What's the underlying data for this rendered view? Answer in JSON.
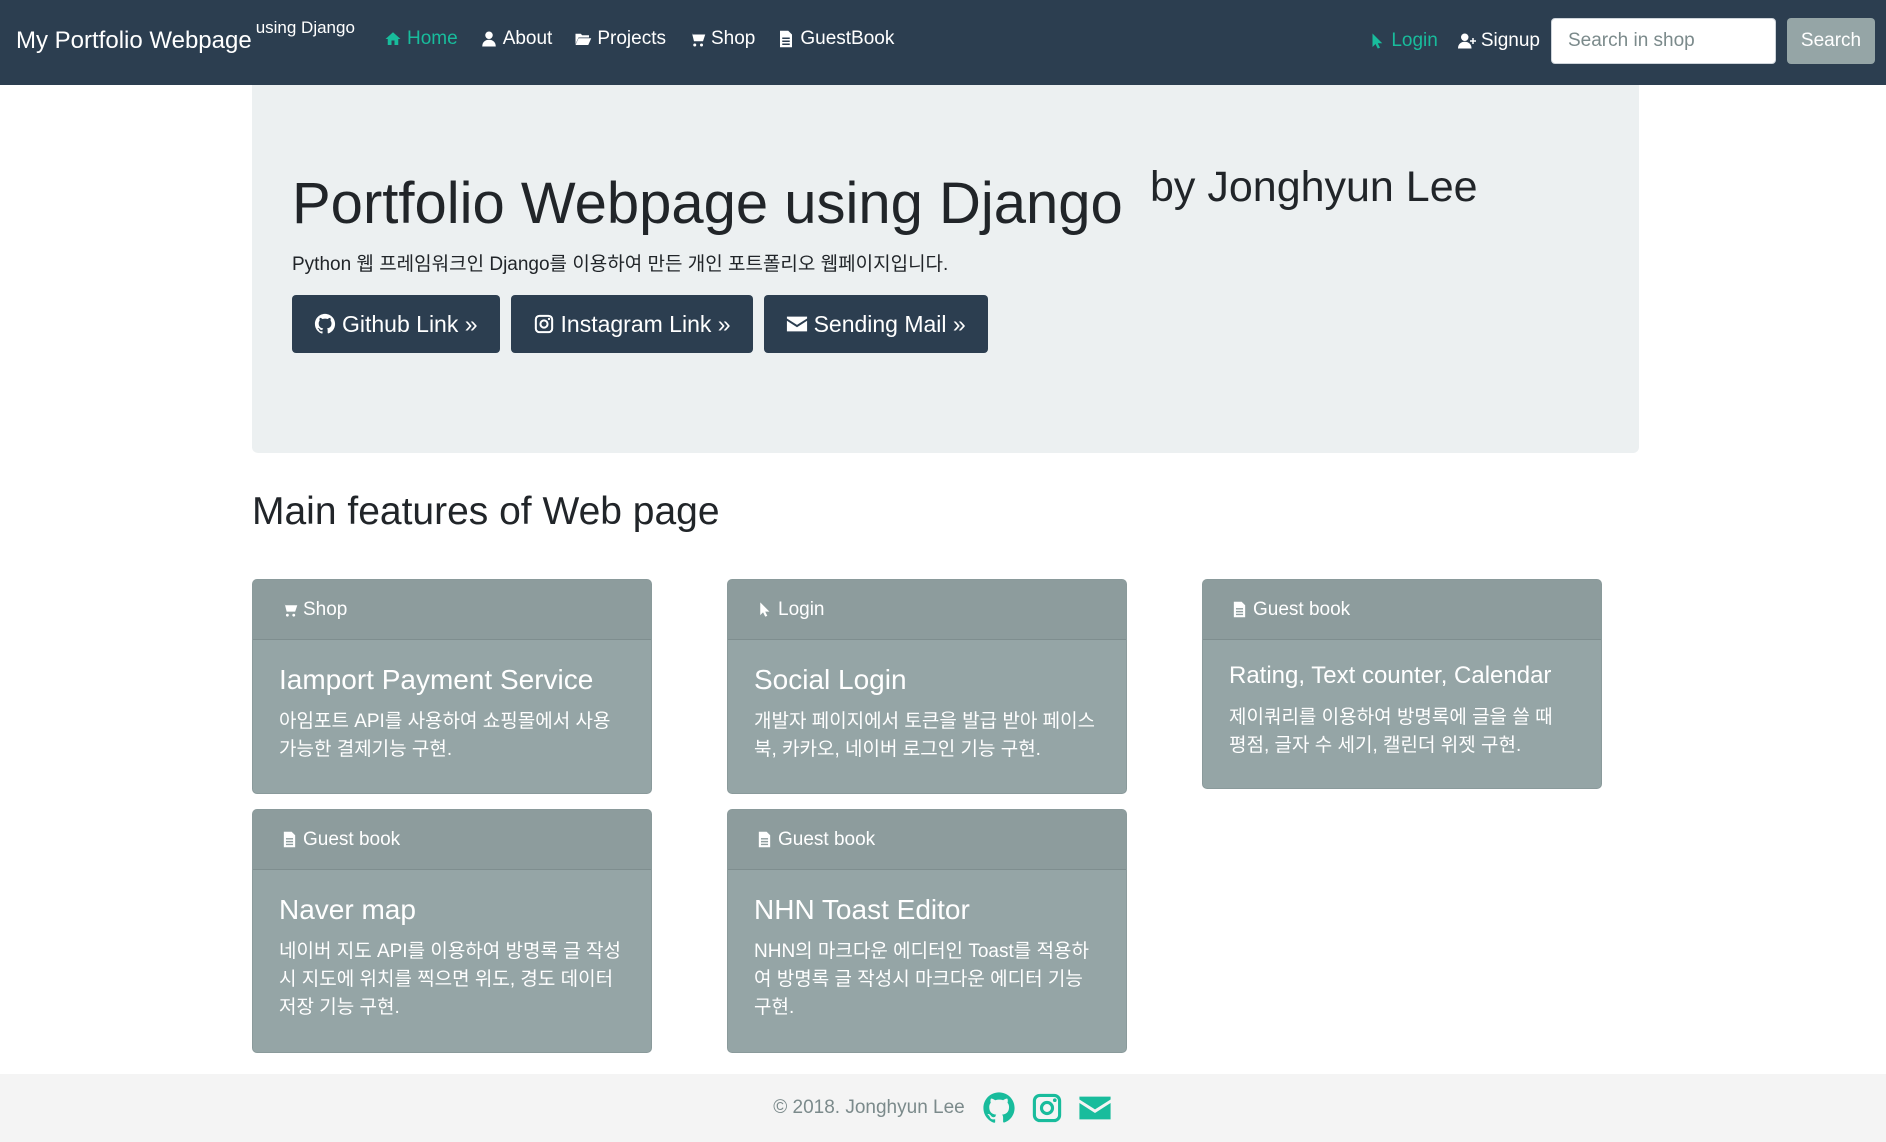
{
  "nav": {
    "brand": "My Portfolio Webpage",
    "brand_sub": "using Django",
    "links": [
      {
        "label": "Home",
        "icon": "home-icon"
      },
      {
        "label": "About",
        "icon": "user-icon"
      },
      {
        "label": "Projects",
        "icon": "folder-open-icon"
      },
      {
        "label": "Shop",
        "icon": "shopping-cart-icon"
      },
      {
        "label": "GuestBook",
        "icon": "file-icon"
      }
    ],
    "login": "Login",
    "signup": "Signup",
    "search_placeholder": "Search in shop",
    "search_button": "Search",
    "accent_color": "#18bc9c",
    "bg_color": "#2c3e50"
  },
  "hero": {
    "title": "Portfolio Webpage using Django",
    "subtitle": "by Jonghyun Lee",
    "description": "Python 웹 프레임워크인 Django를 이용하여 만든 개인 포트폴리오 웹페이지입니다.",
    "buttons": [
      {
        "label": "Github Link »",
        "icon": "github-icon"
      },
      {
        "label": "Instagram Link »",
        "icon": "instagram-icon"
      },
      {
        "label": "Sending Mail »",
        "icon": "envelope-icon"
      }
    ]
  },
  "features": {
    "heading": "Main features of Web page",
    "cards": [
      {
        "header": "Shop",
        "icon": "shopping-cart-icon",
        "title": "Iamport Payment Service",
        "text": "아임포트 API를 사용하여 쇼핑몰에서 사용 가능한 결제기능 구현."
      },
      {
        "header": "Login",
        "icon": "mouse-pointer-icon",
        "title": "Social Login",
        "text": "개발자 페이지에서 토큰을 발급 받아 페이스북, 카카오, 네이버 로그인 기능 구현."
      },
      {
        "header": "Guest book",
        "icon": "file-icon",
        "title": "Rating, Text counter, Calendar",
        "text": "제이쿼리를 이용하여 방명록에 글을 쓸 때 평점, 글자 수 세기, 캘린더 위젯 구현."
      },
      {
        "header": "Guest book",
        "icon": "file-icon",
        "title": "Naver map",
        "text": "네이버 지도 API를 이용하여 방명록 글 작성시 지도에 위치를 찍으면 위도, 경도 데이터 저장 기능 구현."
      },
      {
        "header": "Guest book",
        "icon": "file-icon",
        "title": "NHN Toast Editor",
        "text": "NHN의 마크다운 에디터인 Toast를 적용하여 방명록 글 작성시 마크다운 에디터 기능 구현."
      }
    ]
  },
  "footer": {
    "copyright": "© 2018. Jonghyun Lee",
    "icons": [
      "github-icon",
      "instagram-icon",
      "envelope-icon"
    ]
  }
}
